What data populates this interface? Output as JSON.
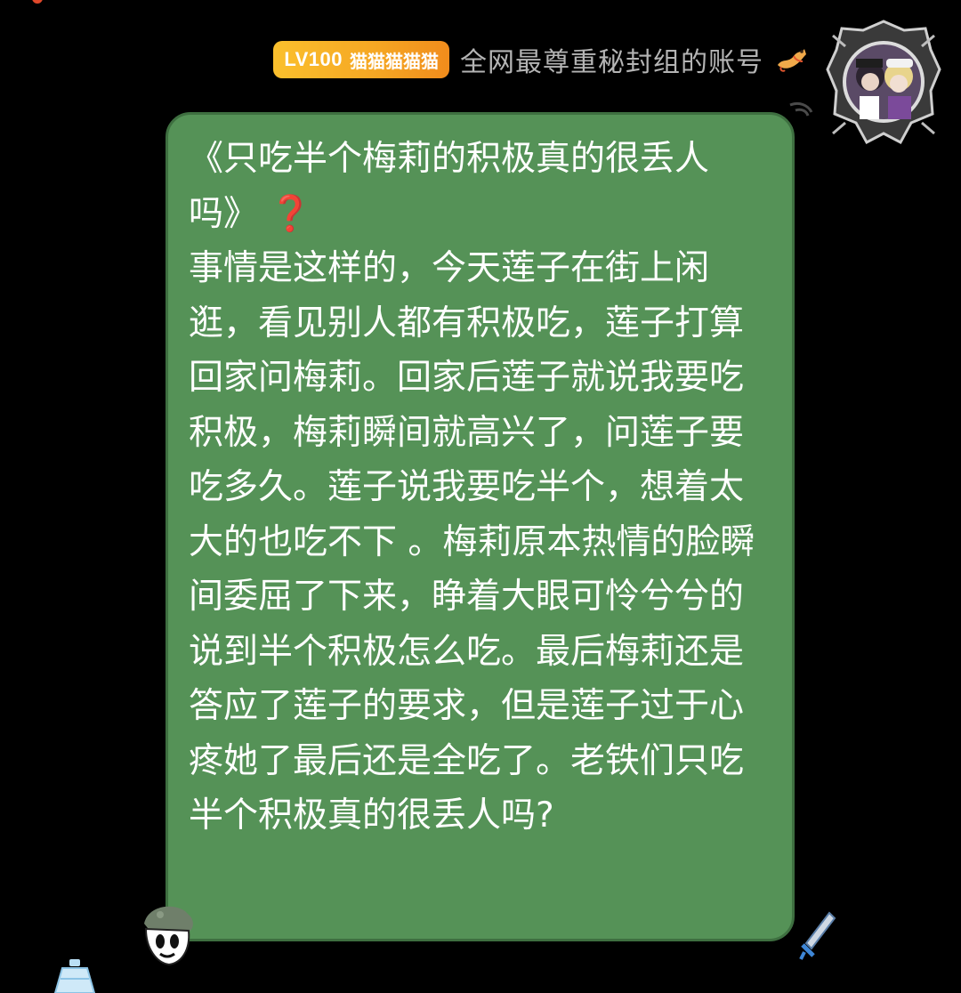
{
  "sender": {
    "level": "LV100",
    "badge_title": "猫猫猫猫猫",
    "name": "全网最尊重秘封组的账号",
    "name_icon": "dragon-icon",
    "avatar_icon": "avatar-frame-icon"
  },
  "message": {
    "text": "《只吃半个梅莉的积极真的很丢人吗》",
    "title_emoji": "❓",
    "body": "事情是这样的，今天莲子在街上闲逛，看见别人都有积极吃，莲子打算回家问梅莉。回家后莲子就说我要吃积极，梅莉瞬间就高兴了，问莲子要吃多久。莲子说我要吃半个，想着太大的也吃不下 。梅莉原本热情的脸瞬间委屈了下来，睁着大眼可怜兮兮的说到半个积极怎么吃。最后梅莉还是答应了莲子的要求，但是莲子过于心疼她了最后还是全吃了。老铁们只吃半个积极真的很丢人吗?"
  },
  "colors": {
    "background": "#000000",
    "bubble": "#559257",
    "bubble_border": "#3e6f40",
    "badge_gradient_start": "#fbc02d",
    "badge_gradient_end": "#f18c1c",
    "sender_name": "#b4b4b4",
    "text": "#ffffff"
  }
}
